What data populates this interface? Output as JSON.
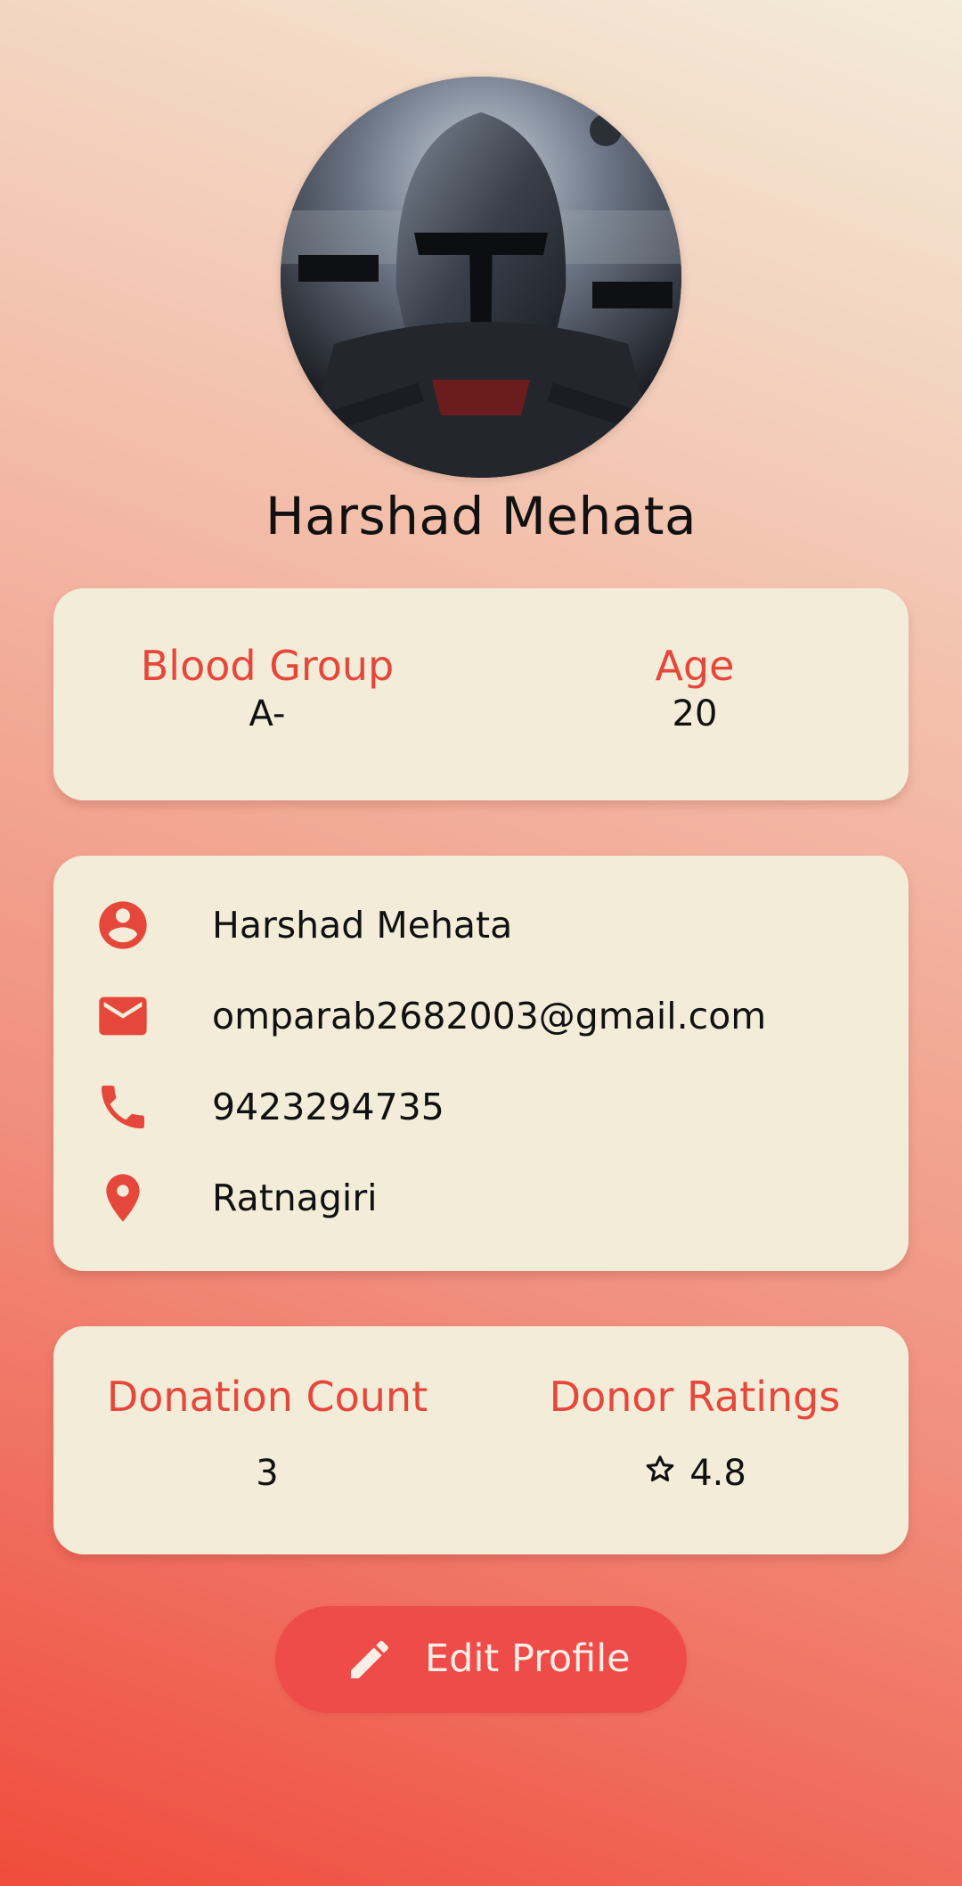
{
  "profile": {
    "name": "Harshad Mehata"
  },
  "summary": {
    "blood_group_label": "Blood Group",
    "blood_group_value": "A-",
    "age_label": "Age",
    "age_value": "20"
  },
  "contact": {
    "items": [
      {
        "icon": "account-circle-icon",
        "value": "Harshad Mehata"
      },
      {
        "icon": "email-icon",
        "value": "omparab2682003@gmail.com"
      },
      {
        "icon": "phone-icon",
        "value": "9423294735"
      },
      {
        "icon": "location-pin-icon",
        "value": "Ratnagiri"
      }
    ]
  },
  "stats": {
    "donation_count_label": "Donation Count",
    "donation_count_value": "3",
    "donor_ratings_label": "Donor Ratings",
    "donor_ratings_value": "4.8"
  },
  "actions": {
    "edit_profile_label": "Edit Profile"
  },
  "colors": {
    "accent": "#e6473b",
    "card_bg": "#f2ecd9",
    "button_bg": "#ef4b48"
  }
}
